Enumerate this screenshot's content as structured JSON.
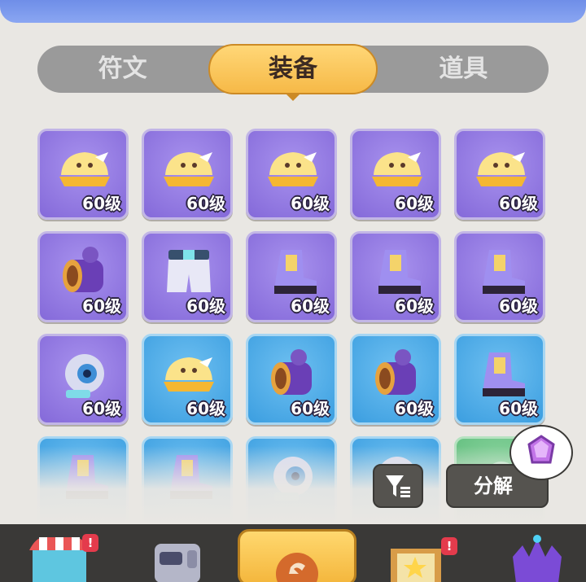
{
  "tabs": {
    "rune_label": "符文",
    "equipment_label": "装备",
    "item_label": "道具",
    "active": "装备"
  },
  "inventory": {
    "items": [
      {
        "icon": "helmet-icon",
        "level": "60级",
        "rarity": "purple"
      },
      {
        "icon": "helmet-icon",
        "level": "60级",
        "rarity": "purple"
      },
      {
        "icon": "helmet-icon",
        "level": "60级",
        "rarity": "purple"
      },
      {
        "icon": "helmet-icon",
        "level": "60级",
        "rarity": "purple"
      },
      {
        "icon": "helmet-icon",
        "level": "60级",
        "rarity": "purple"
      },
      {
        "icon": "bracer-icon",
        "level": "60级",
        "rarity": "purple"
      },
      {
        "icon": "shorts-icon",
        "level": "60级",
        "rarity": "purple"
      },
      {
        "icon": "boots-icon",
        "level": "60级",
        "rarity": "purple"
      },
      {
        "icon": "boots-icon",
        "level": "60级",
        "rarity": "purple"
      },
      {
        "icon": "boots-icon",
        "level": "60级",
        "rarity": "purple"
      },
      {
        "icon": "eye-orb-icon",
        "level": "60级",
        "rarity": "purple"
      },
      {
        "icon": "helmet-icon",
        "level": "60级",
        "rarity": "blue"
      },
      {
        "icon": "bracer-icon",
        "level": "60级",
        "rarity": "blue"
      },
      {
        "icon": "bracer-icon",
        "level": "60级",
        "rarity": "blue"
      },
      {
        "icon": "boots-icon",
        "level": "60级",
        "rarity": "blue"
      },
      {
        "icon": "boots-icon",
        "level": "",
        "rarity": "blue"
      },
      {
        "icon": "boots-icon",
        "level": "",
        "rarity": "blue"
      },
      {
        "icon": "eye-orb-icon",
        "level": "",
        "rarity": "blue"
      },
      {
        "icon": "eye-orb-icon",
        "level": "",
        "rarity": "blue"
      },
      {
        "icon": "unknown-icon",
        "level": "",
        "rarity": "green"
      }
    ]
  },
  "actions": {
    "decompose_label": "分解",
    "filter_icon": "filter-icon",
    "gem_icon": "purple-gem-icon"
  },
  "bottom_nav": {
    "badge_text": "!",
    "items": [
      "shop-icon",
      "robot-icon",
      "home-icon",
      "quest-board-icon",
      "crown-icon"
    ]
  },
  "colors": {
    "tab_active": "#f6b947",
    "slot_purple": "#8469d9",
    "slot_blue": "#3b9ee0",
    "slot_green": "#5fbd7c",
    "badge": "#e43b4c"
  }
}
